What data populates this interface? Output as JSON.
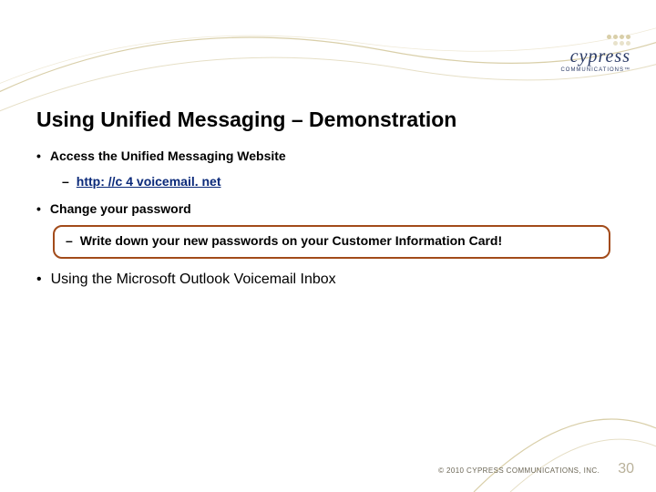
{
  "logo": {
    "name": "cypress",
    "sub": "COMMUNICATIONS™"
  },
  "title": "Using Unified Messaging – Demonstration",
  "bullets": {
    "access": {
      "label": "Access the Unified Messaging Website",
      "sub_link": "http: //c 4 voicemail. net"
    },
    "change": {
      "label": "Change your password",
      "callout": "Write down your new passwords on your Customer Information Card!"
    },
    "outlook": {
      "label": "Using the Microsoft Outlook Voicemail Inbox"
    }
  },
  "footer": {
    "copyright": "© 2010 CYPRESS COMMUNICATIONS, INC.",
    "page": "30"
  }
}
